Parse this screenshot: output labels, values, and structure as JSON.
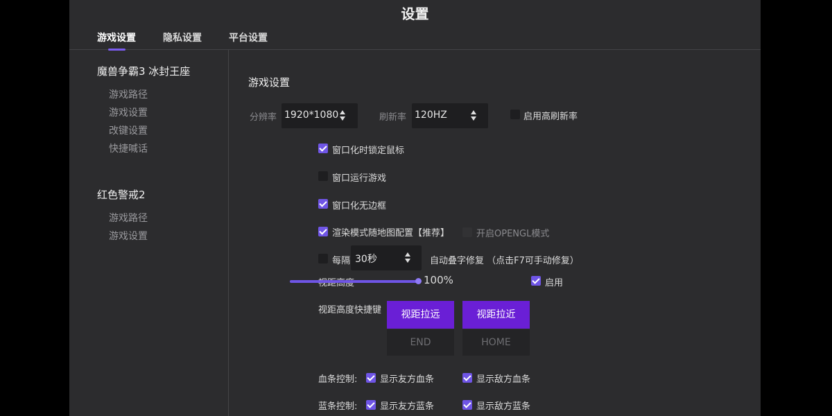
{
  "window": {
    "title": "设置"
  },
  "tabs": [
    {
      "label": "游戏设置"
    },
    {
      "label": "隐私设置"
    },
    {
      "label": "平台设置"
    }
  ],
  "sidebar": {
    "games": [
      {
        "title": "魔兽争霸3 冰封王座",
        "items": [
          "游戏路径",
          "游戏设置",
          "改键设置",
          "快捷喊话"
        ]
      },
      {
        "title": "红色警戒2",
        "items": [
          "游戏路径",
          "游戏设置"
        ]
      }
    ]
  },
  "main": {
    "section_title": "游戏设置",
    "resolution": {
      "label": "分辨率",
      "value": "1920*1080"
    },
    "refresh": {
      "label": "刷新率",
      "value": "120HZ"
    },
    "high_refresh": {
      "label": "启用高刷新率",
      "checked": false
    },
    "lock_mouse": {
      "label": "窗口化时锁定鼠标",
      "checked": true
    },
    "windowed": {
      "label": "窗口运行游戏",
      "checked": false
    },
    "borderless": {
      "label": "窗口化无边框",
      "checked": true
    },
    "render_mode": {
      "label": "渲染模式随地图配置【推荐】",
      "checked": true
    },
    "opengl": {
      "label": "开启OPENGL模式",
      "checked": false
    },
    "auto_fix": {
      "prefix": "每隔",
      "interval": "30秒",
      "suffix": "自动叠字修复 （点击F7可手动修复）",
      "checked": false
    },
    "view_height": {
      "label": "视距高度",
      "percent_text": "100%",
      "level": 1.0,
      "enable_label": "启用",
      "enabled": true
    },
    "hotkeys": {
      "label": "视距高度快捷键",
      "zoom_out": {
        "label": "视距拉远",
        "key": "END"
      },
      "zoom_in": {
        "label": "视距拉近",
        "key": "HOME"
      }
    },
    "hp_bar": {
      "label": "血条控制:",
      "ally": {
        "label": "显示友方血条",
        "checked": true
      },
      "enemy": {
        "label": "显示敌方血条",
        "checked": true
      }
    },
    "mp_bar": {
      "label": "蓝条控制:",
      "ally": {
        "label": "显示友方蓝条",
        "checked": true
      },
      "enemy": {
        "label": "显示敌方蓝条",
        "checked": true
      }
    }
  },
  "colors": {
    "accent": "#6f55e6",
    "button": "#6a1fd6",
    "background": "#2c2c2e"
  }
}
